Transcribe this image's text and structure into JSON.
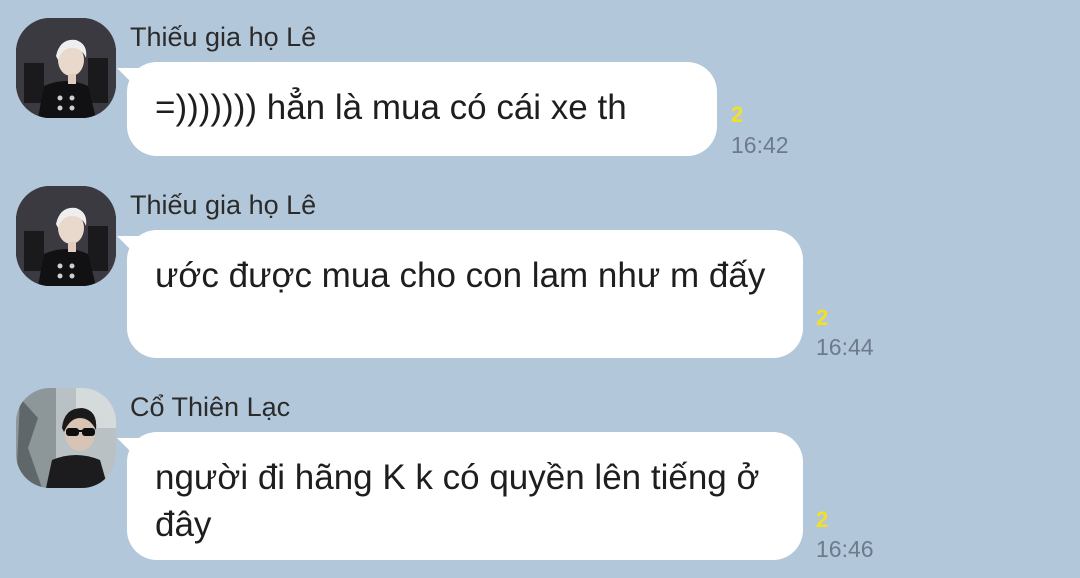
{
  "messages": [
    {
      "sender": "Thiếu gia họ Lê",
      "text": "=))))))) hẳn là mua có cái xe th",
      "unread": "2",
      "time": "16:42",
      "avatar": "avatar-man-white-hair"
    },
    {
      "sender": "Thiếu gia họ Lê",
      "text": "ước được mua cho con lam như m đấy",
      "unread": "2",
      "time": "16:44",
      "avatar": "avatar-man-white-hair"
    },
    {
      "sender": "Cổ Thiên Lạc",
      "text": "người đi hãng K k có quyền lên tiếng ở đây",
      "unread": "2",
      "time": "16:46",
      "avatar": "avatar-man-sunglasses"
    }
  ],
  "colors": {
    "background": "#b3c7da",
    "bubble": "#ffffff",
    "unread": "#f2e021",
    "time": "#6c7b8b"
  }
}
